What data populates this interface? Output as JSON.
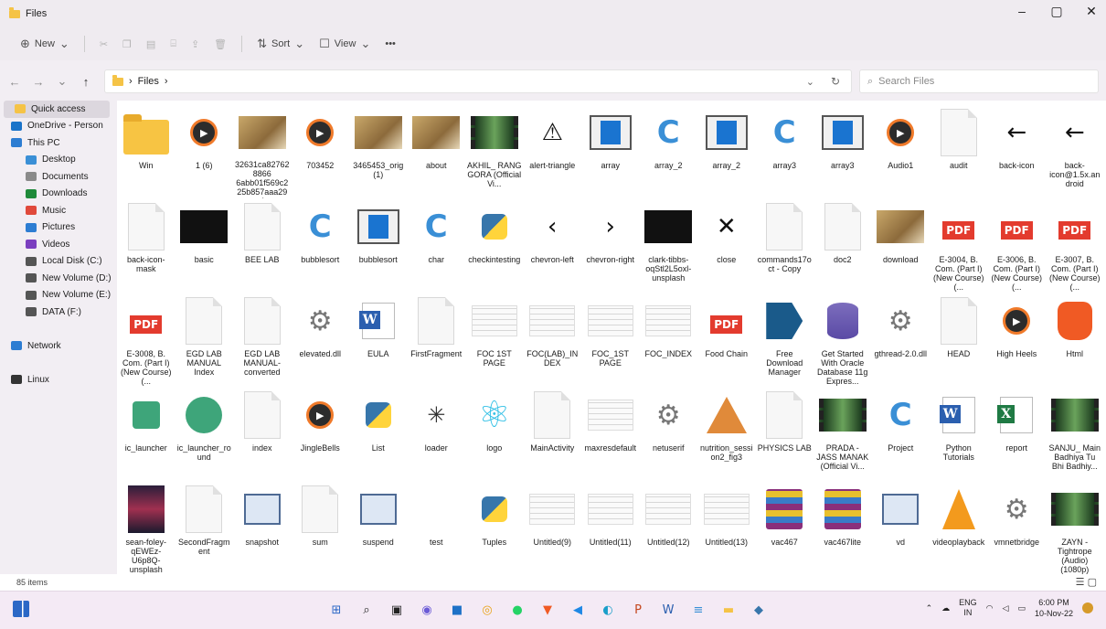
{
  "window": {
    "title": "Files",
    "controls": [
      "–",
      "▢",
      "✕"
    ]
  },
  "toolbar": {
    "new_label": "New",
    "sort_label": "Sort",
    "view_label": "View",
    "more_label": "•••"
  },
  "address": {
    "path_text": "Files",
    "search_placeholder": "Search Files"
  },
  "sidebar": {
    "items": [
      {
        "label": "Quick access",
        "icon": "star-icon",
        "color": "#f5c346"
      },
      {
        "label": "OneDrive - Person",
        "icon": "cloud-icon",
        "color": "#1a73c9"
      },
      {
        "label": "This PC",
        "icon": "pc-icon",
        "color": "#2d7dd2"
      },
      {
        "label": "Desktop",
        "icon": "desktop-icon",
        "color": "#3a8fd6"
      },
      {
        "label": "Documents",
        "icon": "documents-icon",
        "color": "#8a8a8a"
      },
      {
        "label": "Downloads",
        "icon": "download-icon",
        "color": "#1f8a3a"
      },
      {
        "label": "Music",
        "icon": "music-icon",
        "color": "#e0493b"
      },
      {
        "label": "Pictures",
        "icon": "pictures-icon",
        "color": "#2d7dd2"
      },
      {
        "label": "Videos",
        "icon": "videos-icon",
        "color": "#7b3fbf"
      },
      {
        "label": "Local Disk (C:)",
        "icon": "disk-icon",
        "color": "#555555"
      },
      {
        "label": "New Volume (D:)",
        "icon": "drive-icon",
        "color": "#555555"
      },
      {
        "label": "New Volume (E:)",
        "icon": "drive-icon",
        "color": "#555555"
      },
      {
        "label": "DATA (F:)",
        "icon": "drive-icon",
        "color": "#555555"
      },
      {
        "label": "",
        "icon": "",
        "color": ""
      },
      {
        "label": "Network",
        "icon": "network-icon",
        "color": "#2d7dd2"
      },
      {
        "label": "",
        "icon": "",
        "color": ""
      },
      {
        "label": "Linux",
        "icon": "linux-icon",
        "color": "#333333"
      }
    ]
  },
  "files": [
    {
      "name": "Win",
      "kind": "folder"
    },
    {
      "name": "1 (6)",
      "kind": "play"
    },
    {
      "name": "32631ca827628866​6abb01f569c225b857aaa294",
      "kind": "photo"
    },
    {
      "name": "703452",
      "kind": "play"
    },
    {
      "name": "3465453_orig (1)",
      "kind": "photo"
    },
    {
      "name": "about",
      "kind": "photo"
    },
    {
      "name": "AKHIL_ RANG GORA (Official Vi...",
      "kind": "film"
    },
    {
      "name": "alert-triangle",
      "kind": "glyph",
      "glyph": "⚠"
    },
    {
      "name": "array",
      "kind": "bluecard"
    },
    {
      "name": "array_2",
      "kind": "c"
    },
    {
      "name": "array_2",
      "kind": "bluecard"
    },
    {
      "name": "array3",
      "kind": "c"
    },
    {
      "name": "array3",
      "kind": "bluecard"
    },
    {
      "name": "Audio1",
      "kind": "play"
    },
    {
      "name": "audit",
      "kind": "doc"
    },
    {
      "name": "back-icon",
      "kind": "glyph",
      "glyph": "←"
    },
    {
      "name": "back-icon@1.5x.android",
      "kind": "glyph",
      "glyph": "←"
    },
    {
      "name": "back-icon-mask",
      "kind": "doc"
    },
    {
      "name": "basic",
      "kind": "dark"
    },
    {
      "name": "BEE LAB",
      "kind": "doc"
    },
    {
      "name": "bubblesort",
      "kind": "c"
    },
    {
      "name": "bubblesort",
      "kind": "bluecard"
    },
    {
      "name": "char",
      "kind": "c"
    },
    {
      "name": "checkintesting",
      "kind": "py"
    },
    {
      "name": "chevron-left",
      "kind": "glyph",
      "glyph": "‹"
    },
    {
      "name": "chevron-right",
      "kind": "glyph",
      "glyph": "›"
    },
    {
      "name": "clark-tibbs-oqStl2L5oxl-unsplash",
      "kind": "dark"
    },
    {
      "name": "close",
      "kind": "glyph",
      "glyph": "✕"
    },
    {
      "name": "commands17oct - Copy",
      "kind": "doc"
    },
    {
      "name": "doc2",
      "kind": "doc"
    },
    {
      "name": "download",
      "kind": "photo"
    },
    {
      "name": "E-3004, B. Com. (Part I) (New Course) (...",
      "kind": "pdf"
    },
    {
      "name": "E-3006, B. Com. (Part I) (New Course) (...",
      "kind": "pdf"
    },
    {
      "name": "E-3007, B. Com. (Part I) (New Course) (...",
      "kind": "pdf"
    },
    {
      "name": "E-3008, B. Com. (Part I) (New Course) (...",
      "kind": "pdf"
    },
    {
      "name": "EGD LAB MANUAL Index",
      "kind": "doc"
    },
    {
      "name": "EGD LAB MANUAL-converted",
      "kind": "doc"
    },
    {
      "name": "elevated.dll",
      "kind": "gear"
    },
    {
      "name": "EULA",
      "kind": "word"
    },
    {
      "name": "FirstFragment",
      "kind": "doc"
    },
    {
      "name": "FOC 1ST PAGE",
      "kind": "sheet"
    },
    {
      "name": "FOC(LAB)_INDEX",
      "kind": "sheet"
    },
    {
      "name": "FOC_1ST PAGE",
      "kind": "sheet"
    },
    {
      "name": "FOC_INDEX",
      "kind": "sheet"
    },
    {
      "name": "Food Chain",
      "kind": "pdf"
    },
    {
      "name": "Free Download Manager",
      "kind": "fdm"
    },
    {
      "name": "Get Started With Oracle Database 11g Expres...",
      "kind": "db"
    },
    {
      "name": "gthread-2.0.dll",
      "kind": "gear"
    },
    {
      "name": "HEAD",
      "kind": "doc"
    },
    {
      "name": "High Heels",
      "kind": "play"
    },
    {
      "name": "Html",
      "kind": "brave"
    },
    {
      "name": "ic_launcher",
      "kind": "androidsq"
    },
    {
      "name": "ic_launcher_round",
      "kind": "android"
    },
    {
      "name": "index",
      "kind": "doc"
    },
    {
      "name": "JingleBells",
      "kind": "play"
    },
    {
      "name": "List",
      "kind": "py"
    },
    {
      "name": "loader",
      "kind": "loader"
    },
    {
      "name": "logo",
      "kind": "react"
    },
    {
      "name": "MainActivity",
      "kind": "doc"
    },
    {
      "name": "maxresdefault",
      "kind": "sheet"
    },
    {
      "name": "netuserif",
      "kind": "gear"
    },
    {
      "name": "nutrition_session2_fig3",
      "kind": "pyr"
    },
    {
      "name": "PHYSICS LAB",
      "kind": "doc"
    },
    {
      "name": "PRADA - JASS MANAK (Official Vi...",
      "kind": "film"
    },
    {
      "name": "Project",
      "kind": "c"
    },
    {
      "name": "Python Tutorials",
      "kind": "word"
    },
    {
      "name": "report",
      "kind": "excel"
    },
    {
      "name": "SANJU_ Main Badhiya Tu Bhi Badhiy...",
      "kind": "film"
    },
    {
      "name": "sean-foley-qEWEz-U6p8Q-unsplash",
      "kind": "poster"
    },
    {
      "name": "SecondFragment",
      "kind": "doc"
    },
    {
      "name": "snapshot",
      "kind": "snap"
    },
    {
      "name": "sum",
      "kind": "doc"
    },
    {
      "name": "suspend",
      "kind": "snap"
    },
    {
      "name": "test",
      "kind": "blank"
    },
    {
      "name": "Tuples",
      "kind": "py"
    },
    {
      "name": "Untitled(9)",
      "kind": "sheet"
    },
    {
      "name": "Untitled(11)",
      "kind": "sheet"
    },
    {
      "name": "Untitled(12)",
      "kind": "sheet"
    },
    {
      "name": "Untitled(13)",
      "kind": "sheet"
    },
    {
      "name": "vac467",
      "kind": "rar"
    },
    {
      "name": "vac467lite",
      "kind": "rar"
    },
    {
      "name": "vd",
      "kind": "snap"
    },
    {
      "name": "videoplayback",
      "kind": "vlc"
    },
    {
      "name": "vmnetbridge",
      "kind": "gear"
    },
    {
      "name": "ZAYN - Tightrope (Audio)(1080p)",
      "kind": "film"
    }
  ],
  "status": {
    "count": "85 items"
  },
  "taskbar": {
    "apps": [
      {
        "name": "start-icon",
        "glyph": "⊞",
        "color": "#2b68c6"
      },
      {
        "name": "search-icon",
        "glyph": "⌕",
        "color": "#222222"
      },
      {
        "name": "taskview-icon",
        "glyph": "▣",
        "color": "#222222"
      },
      {
        "name": "chat-icon",
        "glyph": "◉",
        "color": "#6b5bd6"
      },
      {
        "name": "store-icon",
        "glyph": "■",
        "color": "#1e72c7"
      },
      {
        "name": "chrome-icon",
        "glyph": "◎",
        "color": "#e8a317"
      },
      {
        "name": "whatsapp-icon",
        "glyph": "●",
        "color": "#25d366"
      },
      {
        "name": "brave-icon",
        "glyph": "▼",
        "color": "#f05a24"
      },
      {
        "name": "vscode-icon",
        "glyph": "◀",
        "color": "#1e88e5"
      },
      {
        "name": "edge-icon",
        "glyph": "◐",
        "color": "#1a9ec9"
      },
      {
        "name": "powerpoint-icon",
        "glyph": "P",
        "color": "#c4471e"
      },
      {
        "name": "word-icon",
        "glyph": "W",
        "color": "#2b5faf"
      },
      {
        "name": "notepad-icon",
        "glyph": "≡",
        "color": "#3a8fd6"
      },
      {
        "name": "files-icon",
        "glyph": "▬",
        "color": "#f5c346"
      },
      {
        "name": "python-icon",
        "glyph": "◆",
        "color": "#3776ab"
      }
    ],
    "lang_top": "ENG",
    "lang_bottom": "IN",
    "time": "6:00 PM",
    "date": "10-Nov-22"
  }
}
